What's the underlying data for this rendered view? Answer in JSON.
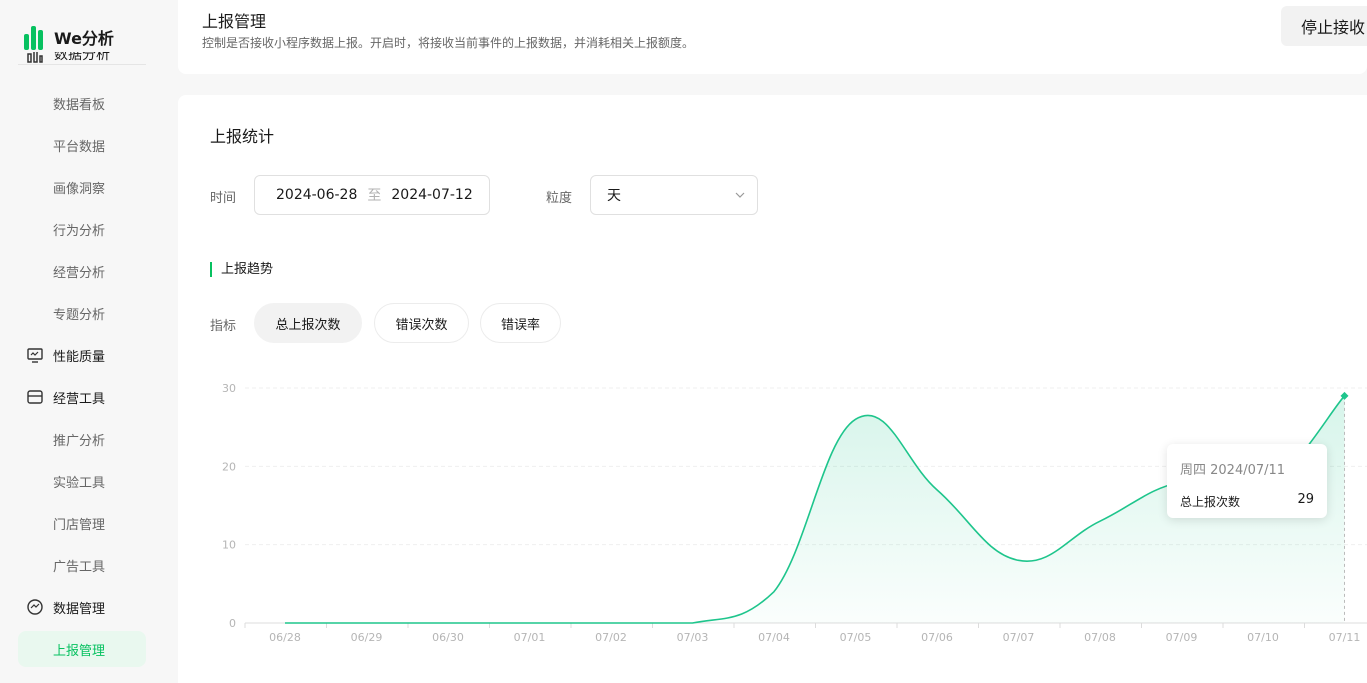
{
  "brand": {
    "name": "We分析"
  },
  "sidebar": {
    "cut_group_label": "数据分析",
    "items": [
      {
        "label": "数据看板",
        "type": "sub"
      },
      {
        "label": "平台数据",
        "type": "sub"
      },
      {
        "label": "画像洞察",
        "type": "sub"
      },
      {
        "label": "行为分析",
        "type": "sub"
      },
      {
        "label": "经营分析",
        "type": "sub"
      },
      {
        "label": "专题分析",
        "type": "sub"
      },
      {
        "label": "性能质量",
        "type": "group",
        "icon": "monitor-icon"
      },
      {
        "label": "经营工具",
        "type": "group",
        "icon": "store-icon"
      },
      {
        "label": "推广分析",
        "type": "sub"
      },
      {
        "label": "实验工具",
        "type": "sub"
      },
      {
        "label": "门店管理",
        "type": "sub"
      },
      {
        "label": "广告工具",
        "type": "sub"
      },
      {
        "label": "数据管理",
        "type": "group",
        "icon": "data-manage-icon"
      },
      {
        "label": "上报管理",
        "type": "sub",
        "active": true
      }
    ]
  },
  "header": {
    "title": "上报管理",
    "description": "控制是否接收小程序数据上报。开启时，将接收当前事件的上报数据，并消耗相关上报额度。",
    "stop_button": "停止接收"
  },
  "stats": {
    "title": "上报统计",
    "time_label": "时间",
    "date_start": "2024-06-28",
    "date_sep": "至",
    "date_end": "2024-07-12",
    "grain_label": "粒度",
    "grain_value": "天",
    "trend_title": "上报趋势",
    "metric_label": "指标",
    "metrics": [
      "总上报次数",
      "错误次数",
      "错误率"
    ],
    "active_metric": "总上报次数"
  },
  "tooltip": {
    "date": "周四 2024/07/11",
    "series": "总上报次数",
    "value": "29"
  },
  "colors": {
    "accent": "#07c160",
    "line": "#1ec58c"
  },
  "chart_data": {
    "type": "area",
    "categories": [
      "06/28",
      "06/29",
      "06/30",
      "07/01",
      "07/02",
      "07/03",
      "07/04",
      "07/05",
      "07/06",
      "07/07",
      "07/08",
      "07/09",
      "07/10",
      "07/11"
    ],
    "series": [
      {
        "name": "总上报次数",
        "values": [
          0,
          0,
          0,
          0,
          0,
          0,
          4,
          26,
          17,
          8,
          13,
          18,
          17,
          29
        ]
      }
    ],
    "ylim": [
      0,
      30
    ],
    "yticks": [
      0,
      10,
      20,
      30
    ],
    "grid": true,
    "highlight_index": 13
  }
}
